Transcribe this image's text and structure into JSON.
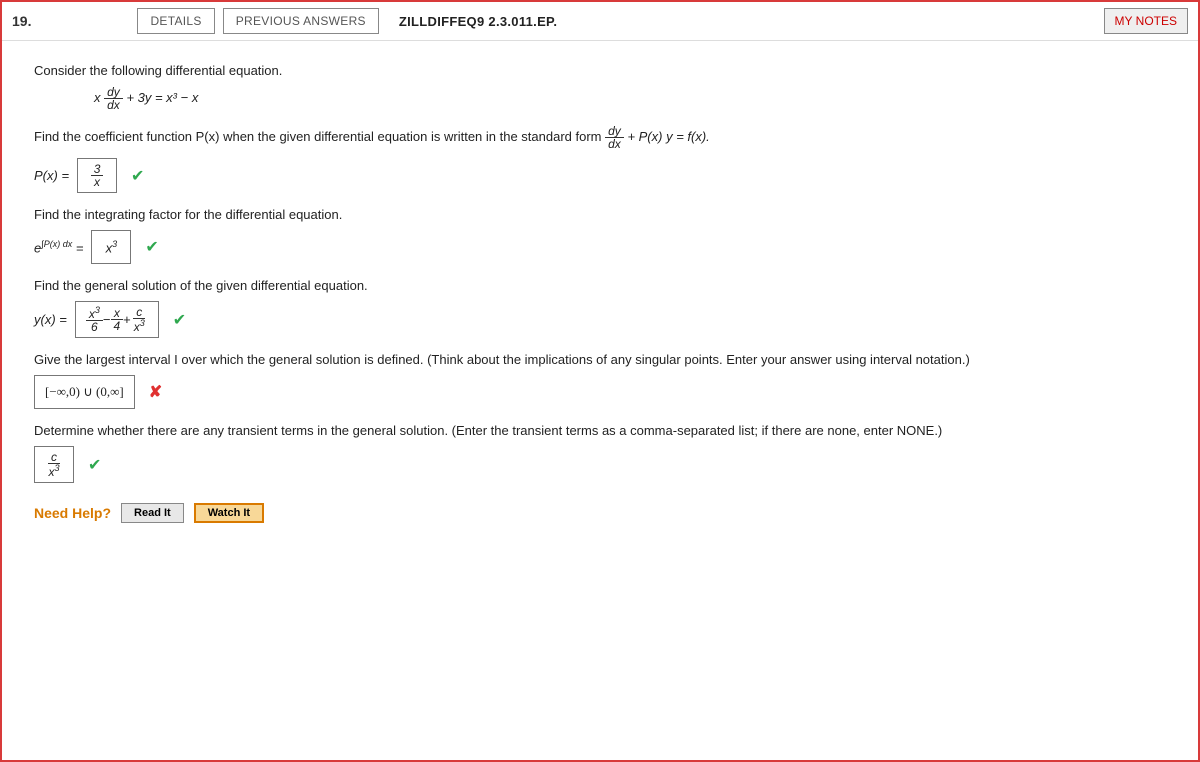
{
  "header": {
    "question_number": "19.",
    "details_btn": "DETAILS",
    "previous_btn": "PREVIOUS ANSWERS",
    "source": "ZILLDIFFEQ9 2.3.011.EP.",
    "mynotes": "MY NOTES"
  },
  "prompts": {
    "intro": "Consider the following differential equation.",
    "p1": "Find the coefficient function P(x) when the given differential equation is written in the standard form ",
    "p2": "Find the integrating factor for the differential equation.",
    "p3": "Find the general solution of the given differential equation.",
    "p4": "Give the largest interval I over which the general solution is defined. (Think about the implications of any singular points. Enter your answer using interval notation.)",
    "p5": "Determine whether there are any transient terms in the general solution. (Enter the transient terms as a comma-separated list; if there are none, enter NONE.)"
  },
  "answers": {
    "px_label": "P(x) =",
    "px_num": "3",
    "px_den": "x",
    "if_label_left": "e",
    "if_label_exp": "∫P(x) dx",
    "if_label_eq": " = ",
    "if_ans_base": "x",
    "if_ans_exp": "3",
    "y_label": "y(x) =",
    "interval": "[−∞,0) ∪ (0,∞]",
    "transient_num": "c",
    "transient_den_base": "x",
    "transient_den_exp": "3"
  },
  "eq": {
    "main_pre": "x",
    "main_num": "dy",
    "main_den": "dx",
    "main_post": " + 3y = x³ − x",
    "std_num": "dy",
    "std_den": "dx",
    "std_post": " + P(x) y = f(x).",
    "y_t1_num_base": "x",
    "y_t1_num_exp": "3",
    "y_t1_den": "6",
    "y_t2_num": "x",
    "y_t2_den": "4",
    "y_t3_num": "c",
    "y_t3_den_base": "x",
    "y_t3_den_exp": "3",
    "minus": " − ",
    "plus": " + "
  },
  "help": {
    "label": "Need Help?",
    "read": "Read It",
    "watch": "Watch It"
  }
}
